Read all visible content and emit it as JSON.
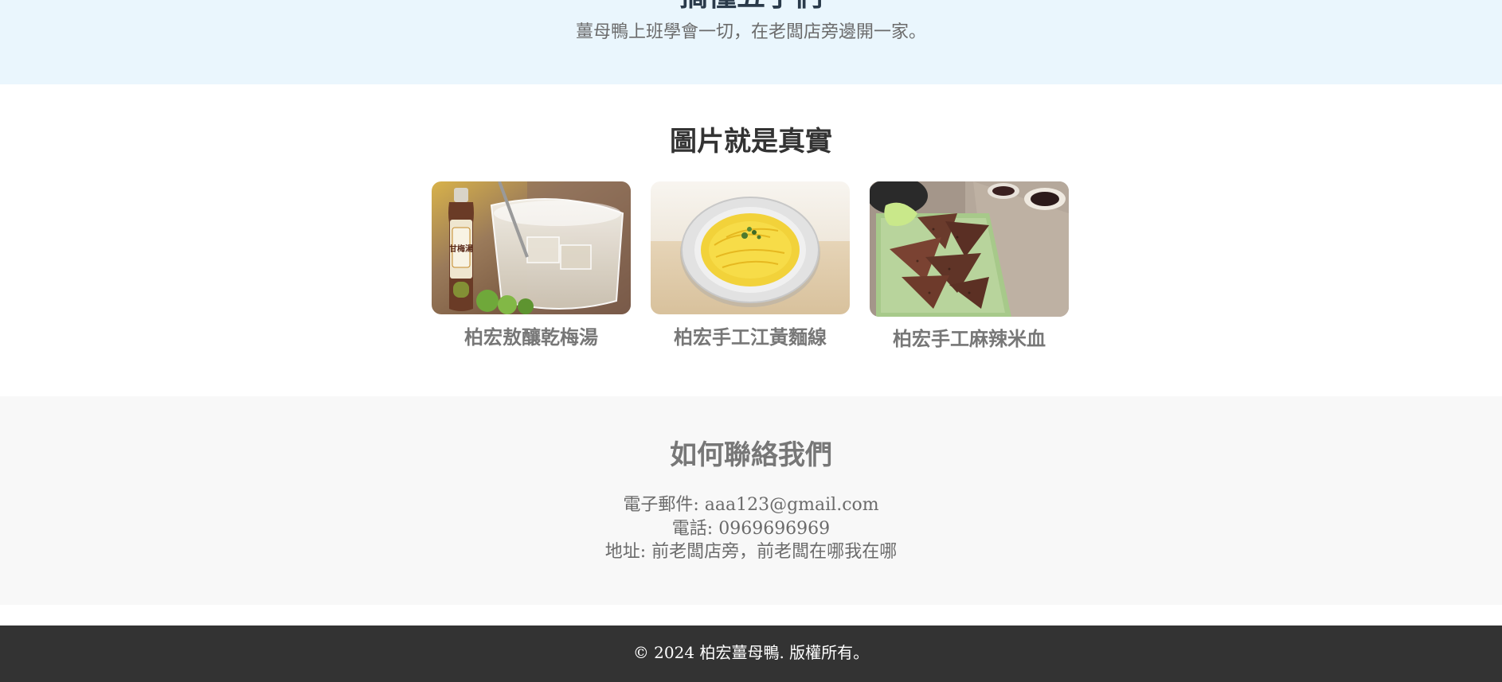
{
  "about": {
    "heading": "搞懂五子們",
    "text": "薑母鴨上班學會一切，在老闆店旁邊開一家。"
  },
  "gallery": {
    "title": "圖片就是真實",
    "items": [
      {
        "label": "柏宏敖釀乾梅湯",
        "bottle_text": "甘梅湯",
        "image": "plum-drink-photo"
      },
      {
        "label": "柏宏手工江黃麵線",
        "image": "noodle-plate-photo"
      },
      {
        "label": "柏宏手工麻辣米血",
        "image": "spicy-rice-cake-photo"
      }
    ]
  },
  "contact": {
    "title": "如何聯絡我們",
    "email": "電子郵件: aaa123@gmail.com",
    "phone": "電話: 0969696969",
    "address": "地址: 前老闆店旁，前老闆在哪我在哪"
  },
  "footer": {
    "copyright": "© 2024 柏宏薑母鴨. 版權所有。"
  },
  "colors": {
    "about_bg": "#eaf6fd",
    "contact_bg": "#f8f8f8",
    "footer_bg": "#333333"
  }
}
